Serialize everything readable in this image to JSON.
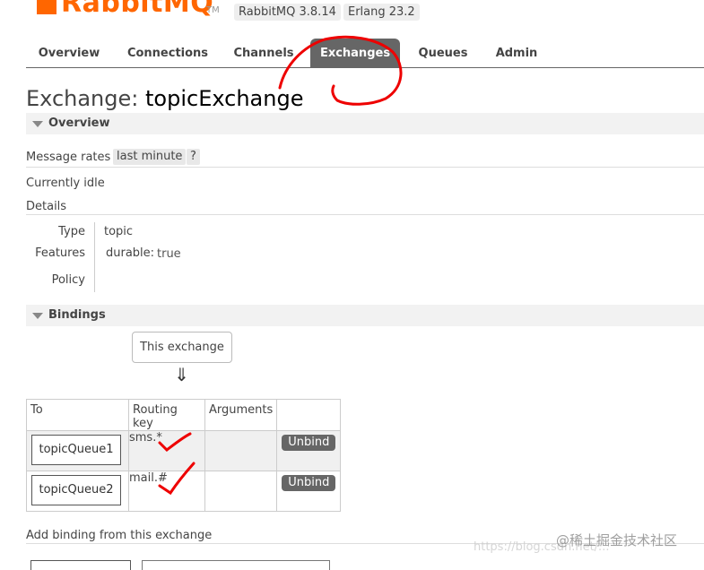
{
  "header": {
    "logo_text": "RabbitMQ",
    "logo_tm": "TM",
    "version_badge": "RabbitMQ 3.8.14",
    "erlang_badge": "Erlang 23.2"
  },
  "tabs": [
    {
      "label": "Overview"
    },
    {
      "label": "Connections"
    },
    {
      "label": "Channels"
    },
    {
      "label": "Exchanges",
      "active": true
    },
    {
      "label": "Queues"
    },
    {
      "label": "Admin"
    }
  ],
  "page": {
    "title_prefix": "Exchange:",
    "title_name": "topicExchange"
  },
  "overview": {
    "section_label": "Overview",
    "message_rates_label": "Message rates",
    "rates_period": "last minute",
    "help": "?",
    "idle_text": "Currently idle",
    "details_label": "Details",
    "details": {
      "type_label": "Type",
      "type_value": "topic",
      "features_label": "Features",
      "features_key": "durable:",
      "features_value": "true",
      "policy_label": "Policy"
    }
  },
  "bindings": {
    "section_label": "Bindings",
    "this_exchange": "This exchange",
    "arrow": "⇓",
    "columns": [
      "To",
      "Routing key",
      "Arguments",
      ""
    ],
    "rows": [
      {
        "to": "topicQueue1",
        "routing_key": "sms.*",
        "arguments": "",
        "action": "Unbind"
      },
      {
        "to": "topicQueue2",
        "routing_key": "mail.#",
        "arguments": "",
        "action": "Unbind"
      }
    ]
  },
  "add_binding": {
    "label": "Add binding from this exchange"
  },
  "watermark": {
    "text": "@稀土掘金技术社区",
    "url_text": "https://blog.csdn.net/..."
  },
  "colors": {
    "brand": "#ff6600",
    "tab_active": "#666666",
    "annotation_red": "#ee0000"
  }
}
